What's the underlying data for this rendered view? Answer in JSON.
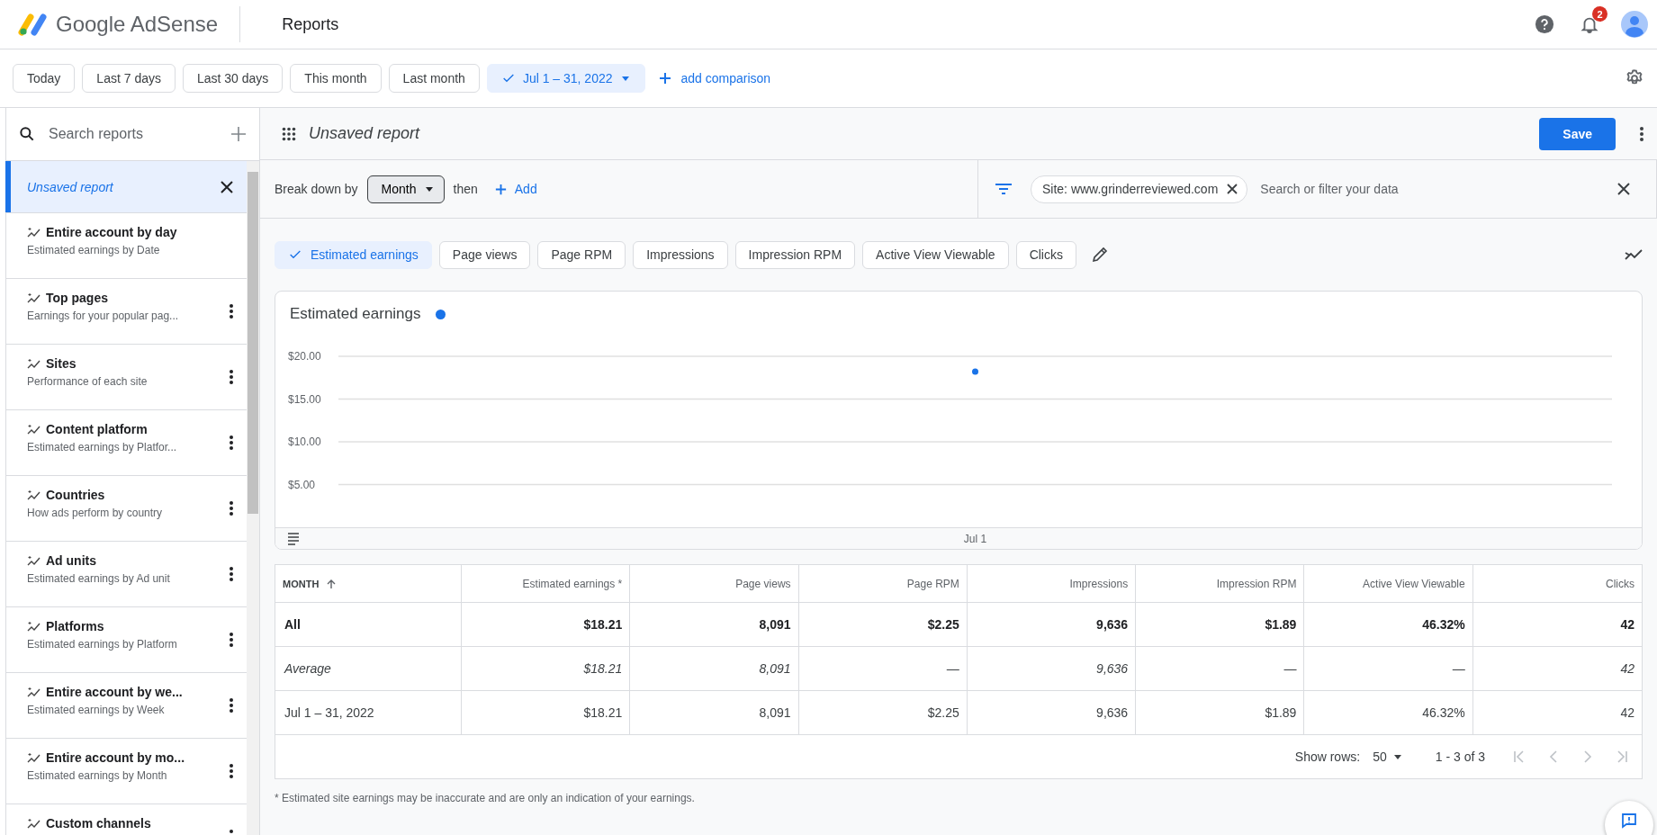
{
  "header": {
    "product": "Google AdSense",
    "page_title": "Reports",
    "notification_count": "2"
  },
  "date_ranges": [
    {
      "label": "Today",
      "selected": false
    },
    {
      "label": "Last 7 days",
      "selected": false
    },
    {
      "label": "Last 30 days",
      "selected": false
    },
    {
      "label": "This month",
      "selected": false
    },
    {
      "label": "Last month",
      "selected": false
    },
    {
      "label": "Jul 1 – 31, 2022",
      "selected": true
    }
  ],
  "add_comparison": "add comparison",
  "sidebar": {
    "search_placeholder": "Search reports",
    "items": [
      {
        "kind": "unsaved",
        "title": "Unsaved report",
        "selected": true
      },
      {
        "kind": "preset",
        "title": "Entire account by day",
        "subtitle": "Estimated earnings by Date",
        "selected": false,
        "menu": false
      },
      {
        "kind": "preset",
        "title": "Top pages",
        "subtitle": "Earnings for your popular pag...",
        "selected": false,
        "menu": true
      },
      {
        "kind": "preset",
        "title": "Sites",
        "subtitle": "Performance of each site",
        "selected": false,
        "menu": true
      },
      {
        "kind": "preset",
        "title": "Content platform",
        "subtitle": "Estimated earnings by Platfor...",
        "selected": false,
        "menu": true
      },
      {
        "kind": "preset",
        "title": "Countries",
        "subtitle": "How ads perform by country",
        "selected": false,
        "menu": true
      },
      {
        "kind": "preset",
        "title": "Ad units",
        "subtitle": "Estimated earnings by Ad unit",
        "selected": false,
        "menu": true
      },
      {
        "kind": "preset",
        "title": "Platforms",
        "subtitle": "Estimated earnings by Platform",
        "selected": false,
        "menu": true
      },
      {
        "kind": "preset",
        "title": "Entire account by we...",
        "subtitle": "Estimated earnings by Week",
        "selected": false,
        "menu": true
      },
      {
        "kind": "preset",
        "title": "Entire account by mo...",
        "subtitle": "Estimated earnings by Month",
        "selected": false,
        "menu": true
      },
      {
        "kind": "preset",
        "title": "Custom channels",
        "selected": false,
        "menu": true
      }
    ]
  },
  "report": {
    "title": "Unsaved report",
    "save": "Save"
  },
  "breakdown": {
    "label": "Break down by",
    "dimension": "Month",
    "then": "then",
    "add": "Add"
  },
  "filter": {
    "chips": [
      "Site: www.grinderreviewed.com"
    ],
    "placeholder": "Search or filter your data"
  },
  "metrics": [
    {
      "label": "Estimated earnings",
      "selected": true
    },
    {
      "label": "Page views",
      "selected": false
    },
    {
      "label": "Page RPM",
      "selected": false
    },
    {
      "label": "Impressions",
      "selected": false
    },
    {
      "label": "Impression RPM",
      "selected": false
    },
    {
      "label": "Active View Viewable",
      "selected": false
    },
    {
      "label": "Clicks",
      "selected": false
    }
  ],
  "chart": {
    "chart_data": {
      "type": "scatter",
      "categories": [
        "Jul 1"
      ],
      "series": [
        {
          "name": "Estimated earnings",
          "color": "#1a73e8",
          "values": [
            18.2
          ]
        }
      ],
      "ylim": [
        0,
        20
      ],
      "grid": true,
      "yticks": [
        {
          "value": 5,
          "label": "$5.00"
        },
        {
          "value": 10,
          "label": "$10.00"
        },
        {
          "value": 15,
          "label": "$15.00"
        },
        {
          "value": 20,
          "label": "$20.00"
        }
      ]
    }
  },
  "table": {
    "columns": [
      "MONTH",
      "Estimated earnings *",
      "Page views",
      "Page RPM",
      "Impressions",
      "Impression RPM",
      "Active View Viewable",
      "Clicks"
    ],
    "rows": [
      {
        "kind": "total",
        "cells": [
          "All",
          "$18.21",
          "8,091",
          "$2.25",
          "9,636",
          "$1.89",
          "46.32%",
          "42"
        ]
      },
      {
        "kind": "average",
        "cells": [
          "Average",
          "$18.21",
          "8,091",
          "—",
          "9,636",
          "—",
          "—",
          "42"
        ]
      },
      {
        "kind": "data",
        "cells": [
          "Jul 1 – 31, 2022",
          "$18.21",
          "8,091",
          "$2.25",
          "9,636",
          "$1.89",
          "46.32%",
          "42"
        ]
      }
    ]
  },
  "pagination": {
    "label": "Show rows:",
    "rows": "50",
    "range": "1 - 3 of 3"
  },
  "footnote": "* Estimated site earnings may be inaccurate and are only an indication of your earnings."
}
